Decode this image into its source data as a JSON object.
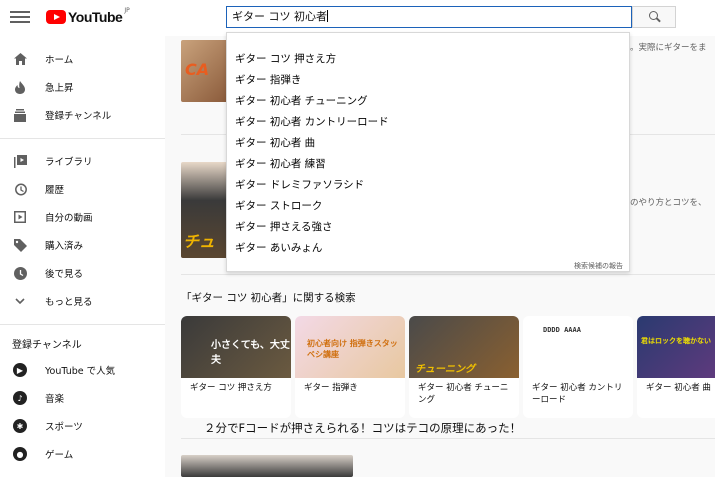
{
  "header": {
    "logo_text": "YouTube",
    "logo_region": "JP",
    "search_value": "ギター コツ 初心者"
  },
  "sidebar": {
    "items": [
      {
        "label": "ホーム",
        "icon": "home-icon"
      },
      {
        "label": "急上昇",
        "icon": "trending-icon"
      },
      {
        "label": "登録チャンネル",
        "icon": "subscriptions-icon"
      },
      {
        "label": "ライブラリ",
        "icon": "library-icon"
      },
      {
        "label": "履歴",
        "icon": "history-icon"
      },
      {
        "label": "自分の動画",
        "icon": "your-videos-icon"
      },
      {
        "label": "購入済み",
        "icon": "purchases-icon"
      },
      {
        "label": "後で見る",
        "icon": "watch-later-icon"
      },
      {
        "label": "もっと見る",
        "icon": "chevron-down-icon"
      }
    ],
    "subscriptions_heading": "登録チャンネル",
    "subscriptions": [
      {
        "label": "YouTube で人気",
        "icon": "youtube-popular-icon"
      },
      {
        "label": "音楽",
        "icon": "music-icon"
      },
      {
        "label": "スポーツ",
        "icon": "sports-icon"
      },
      {
        "label": "ゲーム",
        "icon": "gaming-icon"
      }
    ]
  },
  "suggestions": [
    "ギター コツ 押さえ方",
    "ギター 指弾き",
    "ギター 初心者 チューニング",
    "ギター 初心者 カントリーロード",
    "ギター 初心者 曲",
    "ギター 初心者 練習",
    "ギター ドレミファソラシド",
    "ギター ストローク",
    "ギター 押さえる強さ",
    "ギター あいみょん"
  ],
  "report_label": "検索候補の報告",
  "results": {
    "snippet_1": "。実際にギターをま",
    "snippet_2": "のやり方とコツを、",
    "thumb_1_text": "CA",
    "thumb_2_text": "チュ",
    "related_title": "「ギター コツ 初心者」に関する検索",
    "related_cards": [
      {
        "label": "ギター コツ 押さえ方",
        "thumb_text": "小さくても、大丈夫"
      },
      {
        "label": "ギター 指弾き",
        "thumb_text": "初心者向け 指弾きスタッベシ講座"
      },
      {
        "label": "ギター 初心者 チューニング",
        "thumb_text": "チューニング"
      },
      {
        "label": "ギター 初心者 カントリーロード",
        "thumb_text": "DDDD AAAA"
      },
      {
        "label": "ギター 初心者 曲",
        "thumb_text": "君はロックを聴かない"
      }
    ],
    "video_title": "２分でFコードが押さえられる！コツはテコの原理にあった！"
  },
  "colors": {
    "brand": "#ff0000",
    "focus_border": "#1c62b9"
  }
}
